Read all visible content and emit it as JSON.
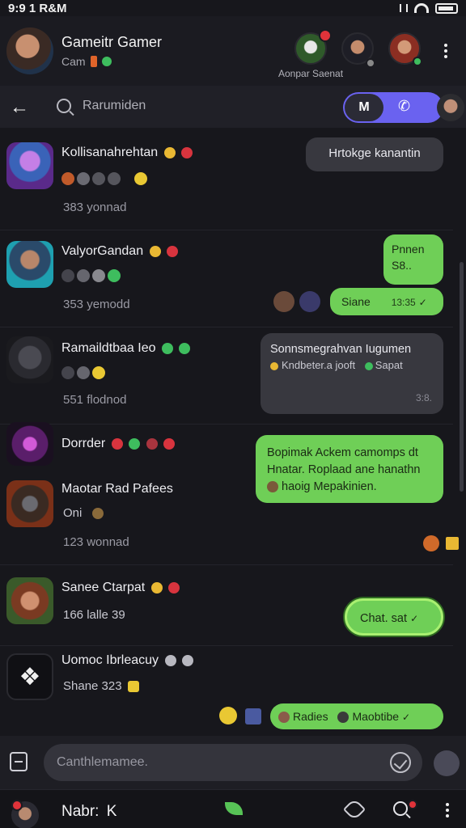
{
  "status_bar": {
    "time": "9:9 1 R&M"
  },
  "header": {
    "title": "Gameitr Gamer",
    "subtitle": "Cam",
    "participants_note": "Aonpar Saenat"
  },
  "search": {
    "placeholder": "Rarumiden",
    "toggle_label": "M"
  },
  "conversations": [
    {
      "name": "Kollisanahrehtan",
      "meta": "383 yonnad",
      "reply": "Hrtokge kanantin",
      "reply_dir": "in"
    },
    {
      "name": "ValyorGandan",
      "meta": "353 yemodd",
      "reply_top": "Pnnen",
      "reply_mid": "S8..",
      "reply_bottom": "Siane",
      "reply_time": "13:35"
    },
    {
      "name": "Ramaildtbaa Ieo",
      "meta": "551 flodnod",
      "reply_line1": "Sonnsmegrahvan Iugumen",
      "reply_line2": "Kndbeter.a jooft",
      "reply_line2b": "Sapat",
      "reply_time": "3:8."
    },
    {
      "name": "Dorrder"
    },
    {
      "name": "Maotar Rad Pafees",
      "sub": "Oni",
      "meta": "123 wonnad",
      "reply_line1": "Bopimak Ackem camomps dt",
      "reply_line2": "Hnatar. Roplaad ane hanathn",
      "reply_line3": "haoig Mepakinien."
    },
    {
      "name": "Sanee Ctarpat",
      "meta": "166 lalle 39",
      "reply": "Chat. sat"
    },
    {
      "name": "Uomoc Ibrleacuy",
      "meta": "Shane 323",
      "reply": "Radies",
      "reply_b": "Maobtibe"
    }
  ],
  "composer": {
    "placeholder": "Canthlemamee."
  },
  "bottom_nav": {
    "name": "Nabr:",
    "name_suffix": "K"
  }
}
